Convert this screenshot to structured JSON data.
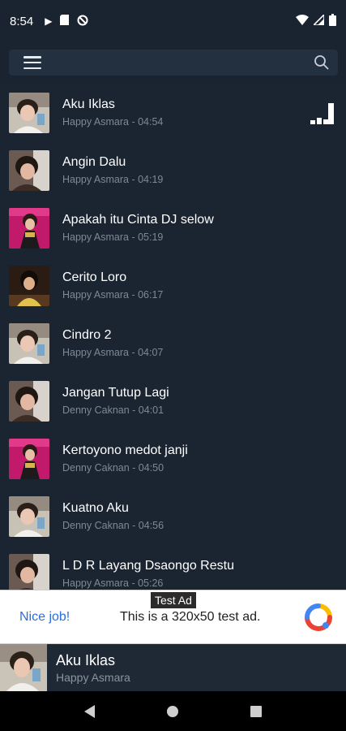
{
  "status": {
    "time": "8:54",
    "left_icons": [
      "play-icon",
      "sd-card-icon",
      "no-sync-icon"
    ],
    "right_icons": [
      "wifi-icon",
      "signal-icon",
      "battery-icon"
    ]
  },
  "toolbar": {
    "menu_icon": "hamburger-menu-icon",
    "search_icon": "search-icon"
  },
  "tracks": [
    {
      "title": "Aku Iklas",
      "subtitle": "Happy Asmara - 04:54",
      "thumb": "photo-a",
      "playing": true
    },
    {
      "title": "Angin Dalu",
      "subtitle": "Happy Asmara - 04:19",
      "thumb": "photo-b"
    },
    {
      "title": "Apakah itu Cinta DJ selow",
      "subtitle": "Happy Asmara - 05:19",
      "thumb": "photo-c"
    },
    {
      "title": "Cerito Loro",
      "subtitle": "Happy Asmara - 06:17",
      "thumb": "photo-d"
    },
    {
      "title": "Cindro 2",
      "subtitle": "Happy Asmara - 04:07",
      "thumb": "photo-a"
    },
    {
      "title": "Jangan Tutup Lagi",
      "subtitle": "Denny Caknan - 04:01",
      "thumb": "photo-b"
    },
    {
      "title": "Kertoyono medot janji",
      "subtitle": "Denny Caknan - 04:50",
      "thumb": "photo-c"
    },
    {
      "title": "Kuatno Aku",
      "subtitle": "Denny Caknan - 04:56",
      "thumb": "photo-a"
    },
    {
      "title": "L D R Layang Dsaongo Restu",
      "subtitle": "Happy Asmara - 05:26",
      "thumb": "photo-b"
    }
  ],
  "ad": {
    "label": "Test Ad",
    "nice": "Nice job!",
    "text": "This is a 320x50 test ad.",
    "logo": "ad-logo-icon"
  },
  "now_playing": {
    "title": "Aku Iklas",
    "artist": "Happy Asmara"
  },
  "nav": {
    "back_icon": "back-icon",
    "home_icon": "home-icon",
    "recents_icon": "recents-icon"
  },
  "colors": {
    "background": "#1a2430",
    "search_bar": "#233040",
    "accent_ad_link": "#2a6ee0"
  }
}
